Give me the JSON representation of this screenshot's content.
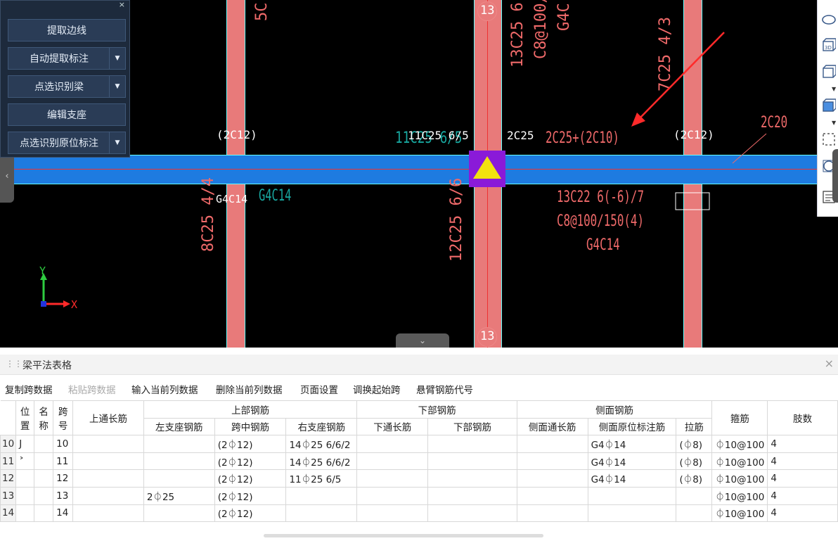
{
  "canvas": {
    "labels": {
      "t_2c12_left": "(2C12)",
      "t_11c25_white": "11C25 6/5",
      "t_11c25_ghost": "11C25 6/5",
      "t_2c25": "2C25",
      "t_2c25_2c10": "2C25+(2C10)",
      "t_2c12_right": "(2C12)",
      "t_2c20": "2C20",
      "t_g4c14_white": "G4C14",
      "t_g4c14_teal": "G4C14",
      "t_13c22": "13C22 6(-6)/7",
      "t_c8": "C8@100/150(4)",
      "t_g4c14_red": "G4C14",
      "v_5c": "5C",
      "v_13c25": "13C25 6(-",
      "v_c8_100": "C8@100/",
      "v_g4c": "G4C",
      "v_7c25": "7C25 4/3",
      "v_8c25": "8C25 4/4",
      "v_12c25": "12C25 6/6",
      "axis_label_top": "13",
      "axis_label_bottom": "13",
      "axis_x": "X",
      "axis_y": "Y"
    },
    "colors": {
      "beam": "#1e7be0",
      "column": "#e87a7a",
      "cad_red": "#f06a6a",
      "teal": "#18a8a0",
      "arrow": "#ff2a2a"
    }
  },
  "panel": {
    "close": "×",
    "buttons": [
      {
        "label": "提取边线",
        "dropdown": false
      },
      {
        "label": "自动提取标注",
        "dropdown": true
      },
      {
        "label": "点选识别梁",
        "dropdown": true
      },
      {
        "label": "编辑支座",
        "dropdown": false
      },
      {
        "label": "点选识别原位标注",
        "dropdown": true
      }
    ]
  },
  "right_toolbar": {
    "icons": [
      "ellipse-icon",
      "3d-box-icon",
      "box-icon",
      "box-filled-icon",
      "dashed-select-icon",
      "rotate-icon",
      "list-icon"
    ]
  },
  "table_panel": {
    "title": "梁平法表格",
    "close": "×",
    "toolbar": [
      {
        "label": "复制跨数据",
        "enabled": true
      },
      {
        "label": "粘贴跨数据",
        "enabled": false
      },
      {
        "label": "输入当前列数据",
        "enabled": true
      },
      {
        "label": "删除当前列数据",
        "enabled": true
      },
      {
        "label": "页面设置",
        "enabled": true
      },
      {
        "label": "调换起始跨",
        "enabled": true
      },
      {
        "label": "悬臂钢筋代号",
        "enabled": true
      }
    ],
    "headers": {
      "pos1": "位",
      "pos2": "置",
      "name1": "名",
      "name2": "称",
      "span1": "跨",
      "span2": "号",
      "top_long": "上通长筋",
      "top_group": "上部钢筋",
      "bottom_group": "下部钢筋",
      "side_group": "侧面钢筋",
      "left_support": "左支座钢筋",
      "mid_span": "跨中钢筋",
      "right_support": "右支座钢筋",
      "bottom_long": "下通长筋",
      "bottom_bar": "下部钢筋",
      "side_long": "侧面通长筋",
      "side_inplace": "侧面原位标注筋",
      "tie": "拉筋",
      "stirrup": "箍筋",
      "legs": "肢数"
    },
    "rows": [
      {
        "rn": "10",
        "pos": "J",
        "name": "",
        "span": "10",
        "top_long": "",
        "left": "",
        "mid": "(2⏀12)",
        "right": "14⏀25 6/6/2",
        "b_long": "",
        "b_bar": "",
        "s_long": "",
        "s_inplace": "G4⏀14",
        "tie": "(⏀8)",
        "stirrup": "⏀10@100",
        "legs": "4"
      },
      {
        "rn": "11",
        "pos": "˃",
        "name": "",
        "span": "11",
        "top_long": "",
        "left": "",
        "mid": "(2⏀12)",
        "right": "14⏀25 6/6/2",
        "b_long": "",
        "b_bar": "",
        "s_long": "",
        "s_inplace": "G4⏀14",
        "tie": "(⏀8)",
        "stirrup": "⏀10@100",
        "legs": "4"
      },
      {
        "rn": "12",
        "pos": "",
        "name": "",
        "span": "12",
        "top_long": "",
        "left": "",
        "mid": "(2⏀12)",
        "right": "11⏀25 6/5",
        "b_long": "",
        "b_bar": "",
        "s_long": "",
        "s_inplace": "G4⏀14",
        "tie": "(⏀8)",
        "stirrup": "⏀10@100",
        "legs": "4"
      },
      {
        "rn": "13",
        "pos": "",
        "name": "",
        "span": "13",
        "top_long": "",
        "left": "2⏀25",
        "mid": "(2⏀12)",
        "right": "",
        "b_long": "",
        "b_bar": "",
        "s_long": "",
        "s_inplace": "",
        "tie": "",
        "stirrup": "⏀10@100",
        "legs": "4"
      },
      {
        "rn": "14",
        "pos": "",
        "name": "",
        "span": "14",
        "top_long": "",
        "left": "",
        "mid": "(2⏀12)",
        "right": "",
        "b_long": "",
        "b_bar": "",
        "s_long": "",
        "s_inplace": "",
        "tie": "",
        "stirrup": "⏀10@100",
        "legs": "4"
      }
    ]
  }
}
